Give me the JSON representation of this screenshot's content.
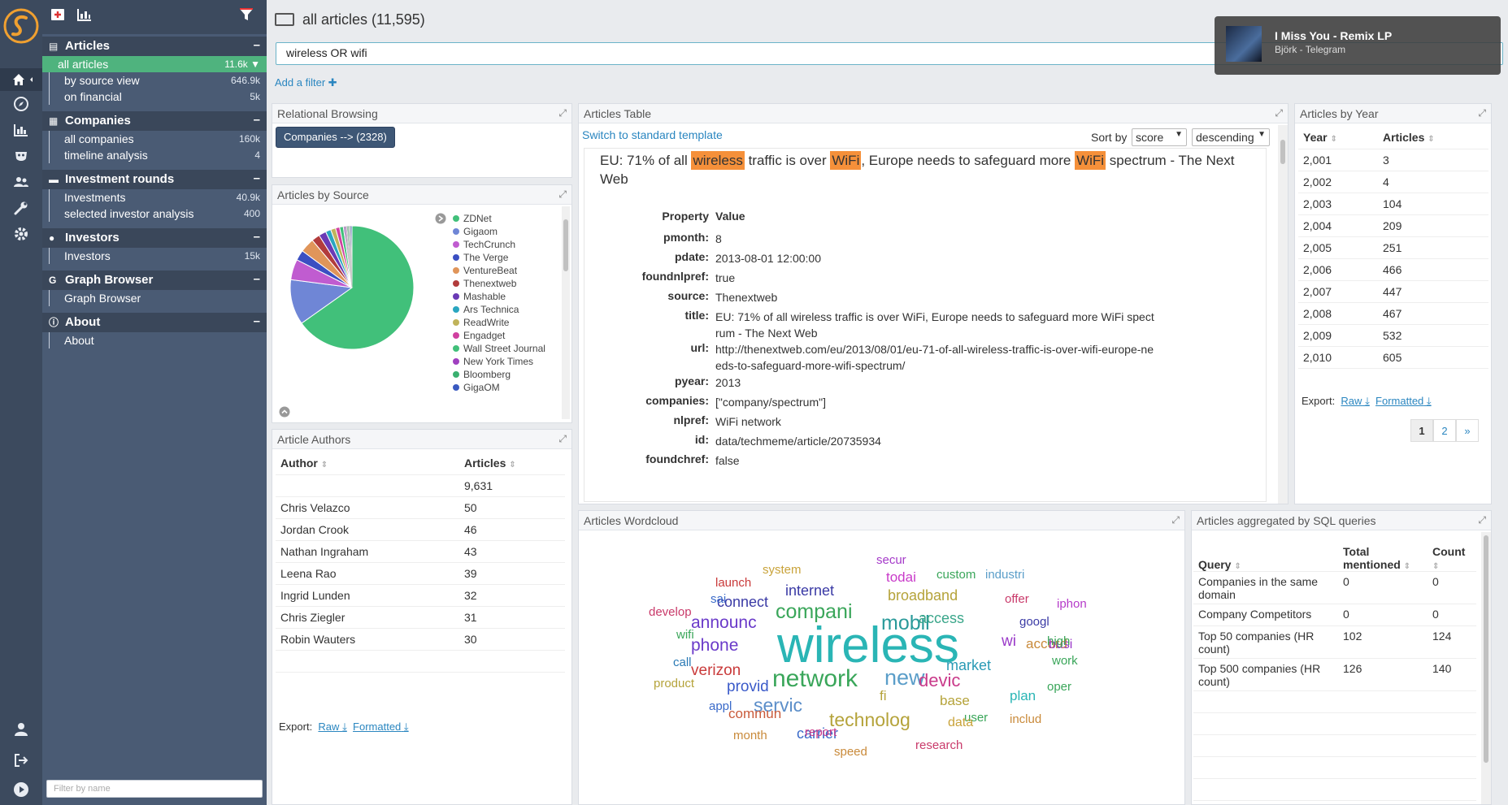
{
  "sidebar": {
    "sections": [
      {
        "title": "Articles",
        "icon": "article-icon",
        "items": [
          {
            "label": "all articles",
            "count": "11.6k",
            "active": true
          },
          {
            "label": "by source view",
            "count": "646.9k"
          },
          {
            "label": "on financial",
            "count": "5k"
          }
        ]
      },
      {
        "title": "Companies",
        "icon": "building-icon",
        "items": [
          {
            "label": "all companies",
            "count": "160k"
          },
          {
            "label": "timeline analysis",
            "count": "4"
          }
        ]
      },
      {
        "title": "Investment rounds",
        "icon": "money-icon",
        "items": [
          {
            "label": "Investments",
            "count": "40.9k"
          },
          {
            "label": "selected investor analysis",
            "count": "400"
          }
        ]
      },
      {
        "title": "Investors",
        "icon": "users-icon",
        "items": [
          {
            "label": "Investors",
            "count": "15k"
          }
        ]
      },
      {
        "title": "Graph Browser",
        "icon": "graph-g-icon",
        "items": [
          {
            "label": "Graph Browser",
            "count": ""
          }
        ]
      },
      {
        "title": "About",
        "icon": "info-icon",
        "items": [
          {
            "label": "About",
            "count": ""
          }
        ]
      }
    ],
    "filter_placeholder": "Filter by name",
    "collapse_symbol": "–",
    "graph_icon_letter": "G"
  },
  "header": {
    "title": "all articles (11,595)",
    "search_value": "wireless OR wifi",
    "add_filter": "Add a filter ✚"
  },
  "notification": {
    "title": "I Miss You - Remix LP",
    "subtitle": "Björk - Telegram"
  },
  "panels": {
    "relational": {
      "title": "Relational Browsing",
      "button": "Companies --> (2328)"
    },
    "by_source": {
      "title": "Articles by Source"
    },
    "authors": {
      "title": "Article Authors",
      "col_author": "Author",
      "col_articles": "Articles",
      "rows": [
        {
          "author": "",
          "articles": "9,631"
        },
        {
          "author": "Chris Velazco",
          "articles": "50"
        },
        {
          "author": "Jordan Crook",
          "articles": "46"
        },
        {
          "author": "Nathan Ingraham",
          "articles": "43"
        },
        {
          "author": "Leena Rao",
          "articles": "39"
        },
        {
          "author": "Ingrid Lunden",
          "articles": "32"
        },
        {
          "author": "Chris Ziegler",
          "articles": "31"
        },
        {
          "author": "Robin Wauters",
          "articles": "30"
        }
      ],
      "export_label": "Export:",
      "raw": "Raw",
      "formatted": "Formatted"
    },
    "table": {
      "title": "Articles Table",
      "switch_template": "Switch to standard template",
      "sort_by": "Sort by",
      "sort_field": "score",
      "sort_order": "descending",
      "article_title_parts": [
        "EU: 71% of all ",
        "wireless",
        " traffic is over ",
        "WiFi",
        ", Europe needs to safeguard more ",
        "WiFi",
        " spectrum - The Next Web"
      ],
      "prop_header": "Property",
      "value_header": "Value",
      "properties": [
        {
          "k": "pmonth:",
          "v": "8"
        },
        {
          "k": "pdate:",
          "v": "2013-08-01 12:00:00"
        },
        {
          "k": "foundnlpref:",
          "v": "true"
        },
        {
          "k": "source:",
          "v": "Thenextweb"
        },
        {
          "k": "title:",
          "v": "EU: 71% of all wireless traffic is over WiFi, Europe needs to safeguard more WiFi spectrum - The Next Web"
        },
        {
          "k": "url:",
          "v": "http://thenextweb.com/eu/2013/08/01/eu-71-of-all-wireless-traffic-is-over-wifi-europe-needs-to-safeguard-more-wifi-spectrum/"
        },
        {
          "k": "pyear:",
          "v": "2013"
        },
        {
          "k": "companies:",
          "v": "[\"company/spectrum\"]"
        },
        {
          "k": "nlpref:",
          "v": "WiFi network"
        },
        {
          "k": "id:",
          "v": "data/techmeme/article/20735934"
        },
        {
          "k": "foundchref:",
          "v": "false"
        }
      ]
    },
    "by_year": {
      "title": "Articles by Year",
      "col_year": "Year",
      "col_articles": "Articles",
      "rows": [
        {
          "year": "2,001",
          "articles": "3"
        },
        {
          "year": "2,002",
          "articles": "4"
        },
        {
          "year": "2,003",
          "articles": "104"
        },
        {
          "year": "2,004",
          "articles": "209"
        },
        {
          "year": "2,005",
          "articles": "251"
        },
        {
          "year": "2,006",
          "articles": "466"
        },
        {
          "year": "2,007",
          "articles": "447"
        },
        {
          "year": "2,008",
          "articles": "467"
        },
        {
          "year": "2,009",
          "articles": "532"
        },
        {
          "year": "2,010",
          "articles": "605"
        }
      ],
      "export_label": "Export:",
      "raw": "Raw",
      "formatted": "Formatted",
      "pages": [
        "1",
        "2",
        "»"
      ]
    },
    "wordcloud": {
      "title": "Articles Wordcloud",
      "words": [
        {
          "text": "wireless",
          "color": "#2ab5b5",
          "size": 62
        },
        {
          "text": "network",
          "color": "#3aa65a",
          "size": 30
        },
        {
          "text": "compani",
          "color": "#3aa65a",
          "size": 25
        },
        {
          "text": "mobil",
          "color": "#2a9a9a",
          "size": 25
        },
        {
          "text": "new",
          "color": "#5b9ec9",
          "size": 27
        },
        {
          "text": "technolog",
          "color": "#b5a33a",
          "size": 23
        },
        {
          "text": "servic",
          "color": "#5b8ec9",
          "size": 23
        },
        {
          "text": "devic",
          "color": "#c93a8a",
          "size": 22
        },
        {
          "text": "announc",
          "color": "#6a3ac9",
          "size": 21
        },
        {
          "text": "phone",
          "color": "#6a3ac9",
          "size": 21
        },
        {
          "text": "verizon",
          "color": "#c93a3a",
          "size": 19
        },
        {
          "text": "provid",
          "color": "#3a5ac9",
          "size": 19
        },
        {
          "text": "broadband",
          "color": "#b5a33a",
          "size": 18
        },
        {
          "text": "connect",
          "color": "#3a3aa5",
          "size": 18
        },
        {
          "text": "internet",
          "color": "#3a3aa5",
          "size": 18
        },
        {
          "text": "carrier",
          "color": "#3a6ac9",
          "size": 18
        },
        {
          "text": "access",
          "color": "#3aa68a",
          "size": 18
        },
        {
          "text": "market",
          "color": "#2a9ab5",
          "size": 18
        },
        {
          "text": "wi",
          "color": "#9a3ac9",
          "size": 19
        },
        {
          "text": "accord",
          "color": "#c98a3a",
          "size": 17
        },
        {
          "text": "plan",
          "color": "#2ab5b5",
          "size": 17
        },
        {
          "text": "base",
          "color": "#b5a33a",
          "size": 17
        },
        {
          "text": "commun",
          "color": "#c95a3a",
          "size": 17
        },
        {
          "text": "system",
          "color": "#c9a33a",
          "size": 15
        },
        {
          "text": "todai",
          "color": "#c93ac9",
          "size": 17
        },
        {
          "text": "custom",
          "color": "#3aa65a",
          "size": 15
        },
        {
          "text": "industri",
          "color": "#5b9ec9",
          "size": 15
        },
        {
          "text": "launch",
          "color": "#c93a3a",
          "size": 15
        },
        {
          "text": "secur",
          "color": "#a53ac9",
          "size": 15
        },
        {
          "text": "offer",
          "color": "#c93a6a",
          "size": 15
        },
        {
          "text": "iphon",
          "color": "#b53ac9",
          "size": 15
        },
        {
          "text": "googl",
          "color": "#3a3aa5",
          "size": 15
        },
        {
          "text": "busi",
          "color": "#9a3ac9",
          "size": 16
        },
        {
          "text": "high",
          "color": "#3aa65a",
          "size": 15
        },
        {
          "text": "work",
          "color": "#3aa65a",
          "size": 15
        },
        {
          "text": "oper",
          "color": "#3aa65a",
          "size": 15
        },
        {
          "text": "develop",
          "color": "#c93a6a",
          "size": 15
        },
        {
          "text": "sai",
          "color": "#3a6ac9",
          "size": 15
        },
        {
          "text": "wifi",
          "color": "#3aa65a",
          "size": 15
        },
        {
          "text": "call",
          "color": "#2a7ab5",
          "size": 15
        },
        {
          "text": "product",
          "color": "#b5a33a",
          "size": 15
        },
        {
          "text": "appl",
          "color": "#3a6ac9",
          "size": 15
        },
        {
          "text": "fi",
          "color": "#b5a33a",
          "size": 17
        },
        {
          "text": "user",
          "color": "#3aa65a",
          "size": 15
        },
        {
          "text": "includ",
          "color": "#c98a3a",
          "size": 15
        },
        {
          "text": "data",
          "color": "#c9a33a",
          "size": 16
        },
        {
          "text": "month",
          "color": "#c98a3a",
          "size": 15
        },
        {
          "text": "report",
          "color": "#c93a8a",
          "size": 15
        },
        {
          "text": "research",
          "color": "#c93a6a",
          "size": 15
        },
        {
          "text": "speed",
          "color": "#c98a3a",
          "size": 15
        }
      ]
    },
    "sql": {
      "title": "Articles aggregated by SQL queries",
      "col_query": "Query",
      "col_total": "Total mentioned",
      "col_count": "Count",
      "rows": [
        {
          "query": "Companies in the same domain",
          "total": "0",
          "count": "0"
        },
        {
          "query": "Company Competitors",
          "total": "0",
          "count": "0"
        },
        {
          "query": "Top 50 companies (HR count)",
          "total": "102",
          "count": "124"
        },
        {
          "query": "Top 500 companies (HR count)",
          "total": "126",
          "count": "140"
        }
      ]
    }
  },
  "chart_data": {
    "type": "pie",
    "title": "",
    "legend": [
      {
        "name": "ZDNet",
        "color": "#41c07a"
      },
      {
        "name": "Gigaom",
        "color": "#6f86d6"
      },
      {
        "name": "TechCrunch",
        "color": "#c05cd0"
      },
      {
        "name": "The Verge",
        "color": "#3b4fc2"
      },
      {
        "name": "VentureBeat",
        "color": "#e0955a"
      },
      {
        "name": "Thenextweb",
        "color": "#b23c3c"
      },
      {
        "name": "Mashable",
        "color": "#6a3ab5"
      },
      {
        "name": "Ars Technica",
        "color": "#2aa6c0"
      },
      {
        "name": "ReadWrite",
        "color": "#c0b35a"
      },
      {
        "name": "Engadget",
        "color": "#d040a0"
      },
      {
        "name": "Wall Street Journal",
        "color": "#41c07a"
      },
      {
        "name": "New York Times",
        "color": "#a040c0"
      },
      {
        "name": "Bloomberg",
        "color": "#3ab070"
      },
      {
        "name": "GigaOM",
        "color": "#3a5ac0"
      }
    ],
    "values": [
      60.5,
      11,
      5,
      2.5,
      3.5,
      2,
      1.8,
      1.3,
      1.2,
      1,
      0.9,
      0.8,
      0.7,
      0.6
    ],
    "legend_placement": "right"
  }
}
